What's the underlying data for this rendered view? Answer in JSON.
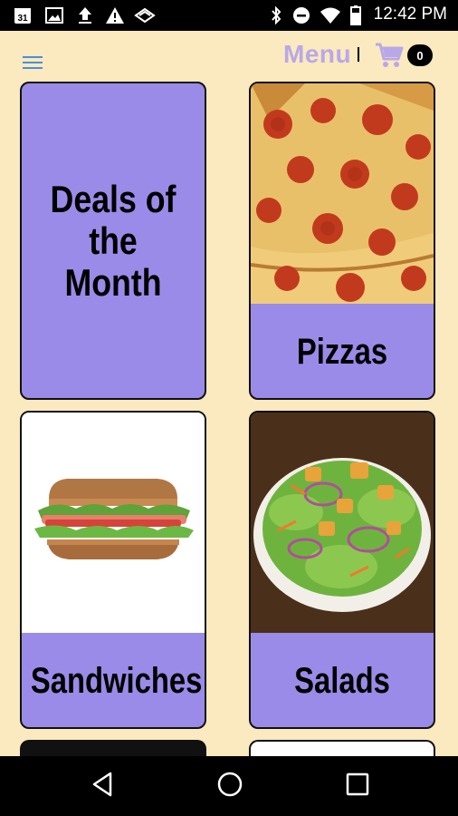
{
  "status_bar": {
    "time": "12:42 PM",
    "calendar_day": "31",
    "icons": [
      "calendar-icon",
      "image-icon",
      "upload-icon",
      "warning-icon",
      "cast-icon",
      "bluetooth-icon",
      "do-not-disturb-icon",
      "wifi-icon",
      "battery-icon"
    ]
  },
  "header": {
    "menu_icon": "hamburger-icon",
    "title": "Menu",
    "cart_icon": "cart-icon",
    "cart_count": "0",
    "accent_color": "#b9a8e8"
  },
  "categories": [
    {
      "label": "Deals of the Month",
      "lines": [
        "Deals of",
        "the",
        "Month"
      ],
      "image": null
    },
    {
      "label": "Pizzas",
      "image": "pepperoni-pizza-photo"
    },
    {
      "label": "Sandwiches",
      "image": "sandwich-photo"
    },
    {
      "label": "Salads",
      "image": "salad-photo"
    }
  ],
  "colors": {
    "background": "#fbe9bf",
    "card": "#9b8be8"
  },
  "nav_bar": {
    "buttons": [
      "back-icon",
      "home-icon",
      "recents-icon"
    ]
  }
}
